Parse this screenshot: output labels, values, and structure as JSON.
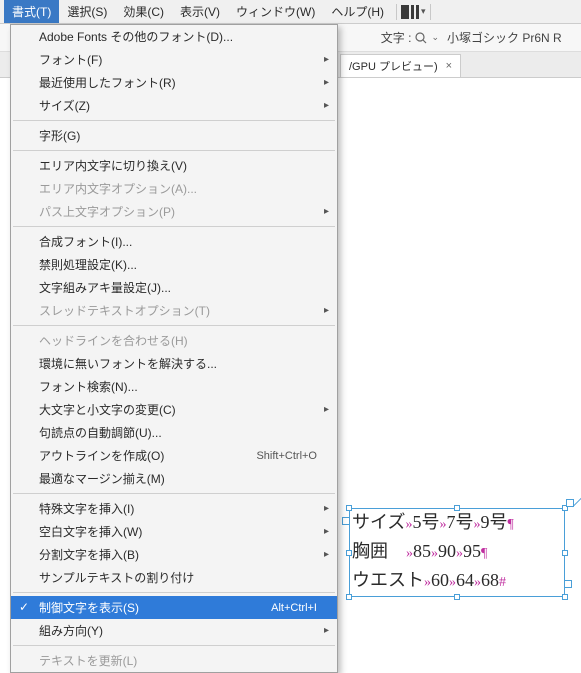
{
  "menubar": {
    "items": [
      {
        "label": "書式(T)",
        "active": true
      },
      {
        "label": "選択(S)"
      },
      {
        "label": "効果(C)"
      },
      {
        "label": "表示(V)"
      },
      {
        "label": "ウィンドウ(W)"
      },
      {
        "label": "ヘルプ(H)"
      }
    ]
  },
  "controlbar": {
    "char_label": "文字 :",
    "font_name": "小塚ゴシック Pr6N R"
  },
  "tab": {
    "label": "/GPU プレビュー)"
  },
  "dropdown": [
    {
      "type": "item",
      "label": "Adobe Fonts その他のフォント(D)..."
    },
    {
      "type": "item",
      "label": "フォント(F)",
      "submenu": true
    },
    {
      "type": "item",
      "label": "最近使用したフォント(R)",
      "submenu": true
    },
    {
      "type": "item",
      "label": "サイズ(Z)",
      "submenu": true
    },
    {
      "type": "sep"
    },
    {
      "type": "item",
      "label": "字形(G)"
    },
    {
      "type": "sep"
    },
    {
      "type": "item",
      "label": "エリア内文字に切り換え(V)"
    },
    {
      "type": "item",
      "label": "エリア内文字オプション(A)...",
      "disabled": true
    },
    {
      "type": "item",
      "label": "パス上文字オプション(P)",
      "submenu": true,
      "disabled": true
    },
    {
      "type": "sep"
    },
    {
      "type": "item",
      "label": "合成フォント(I)..."
    },
    {
      "type": "item",
      "label": "禁則処理設定(K)..."
    },
    {
      "type": "item",
      "label": "文字組みアキ量設定(J)..."
    },
    {
      "type": "item",
      "label": "スレッドテキストオプション(T)",
      "submenu": true,
      "disabled": true
    },
    {
      "type": "sep"
    },
    {
      "type": "item",
      "label": "ヘッドラインを合わせる(H)",
      "disabled": true
    },
    {
      "type": "item",
      "label": "環境に無いフォントを解決する..."
    },
    {
      "type": "item",
      "label": "フォント検索(N)..."
    },
    {
      "type": "item",
      "label": "大文字と小文字の変更(C)",
      "submenu": true
    },
    {
      "type": "item",
      "label": "句読点の自動調節(U)..."
    },
    {
      "type": "item",
      "label": "アウトラインを作成(O)",
      "shortcut": "Shift+Ctrl+O"
    },
    {
      "type": "item",
      "label": "最適なマージン揃え(M)"
    },
    {
      "type": "sep"
    },
    {
      "type": "item",
      "label": "特殊文字を挿入(I)",
      "submenu": true
    },
    {
      "type": "item",
      "label": "空白文字を挿入(W)",
      "submenu": true
    },
    {
      "type": "item",
      "label": "分割文字を挿入(B)",
      "submenu": true
    },
    {
      "type": "item",
      "label": "サンプルテキストの割り付け"
    },
    {
      "type": "sep"
    },
    {
      "type": "item",
      "label": "制御文字を表示(S)",
      "shortcut": "Alt+Ctrl+I",
      "checked": true,
      "highlight": true
    },
    {
      "type": "item",
      "label": "組み方向(Y)",
      "submenu": true
    },
    {
      "type": "sep"
    },
    {
      "type": "item",
      "label": "テキストを更新(L)",
      "disabled": true
    }
  ],
  "textframe": {
    "rows": [
      {
        "cells": [
          "サイズ",
          "5号",
          "7号",
          "9号"
        ],
        "end": "¶"
      },
      {
        "cells": [
          "胸囲",
          "85",
          "90",
          "95"
        ],
        "end": "¶",
        "pad": "　"
      },
      {
        "cells": [
          "ウエスト",
          "60",
          "64",
          "68"
        ],
        "end": "#"
      }
    ],
    "tab_marker": "»"
  }
}
